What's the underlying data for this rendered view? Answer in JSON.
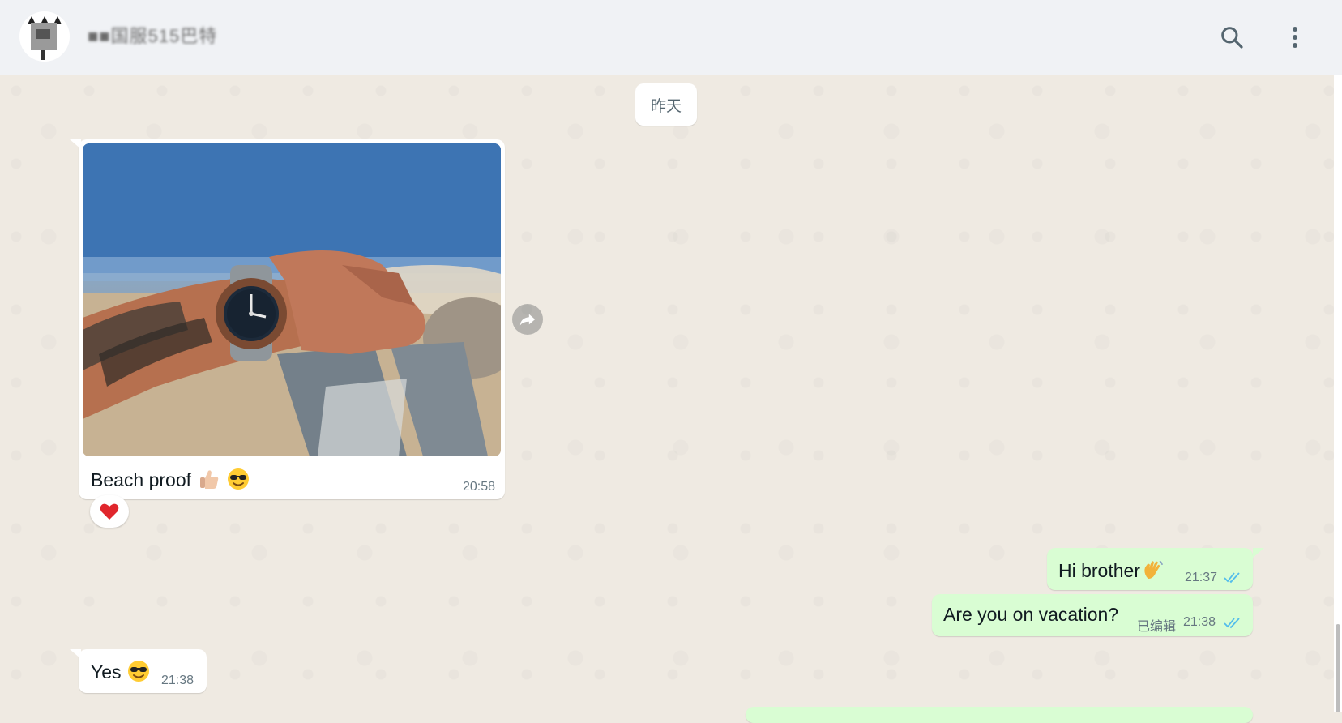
{
  "header": {
    "contact_name": "■■国服515巴特",
    "search_icon": "search-icon",
    "menu_icon": "more-vertical-icon"
  },
  "date_divider": "昨天",
  "messages": [
    {
      "direction": "in",
      "type": "image",
      "caption": "Beach proof",
      "time": "20:58",
      "reaction": "heart"
    },
    {
      "direction": "out",
      "text": "Hi brother",
      "time": "21:37",
      "status": "read"
    },
    {
      "direction": "out",
      "text": "Are you on vacation?",
      "edited_label": "已编辑",
      "time": "21:38",
      "status": "read"
    },
    {
      "direction": "in",
      "text": "Yes",
      "time": "21:38"
    }
  ],
  "colors": {
    "header_bg": "#f0f2f5",
    "chat_bg": "#efeae2",
    "incoming_bubble": "#ffffff",
    "outgoing_bubble": "#d9fdd3",
    "read_tick": "#53bdeb"
  }
}
